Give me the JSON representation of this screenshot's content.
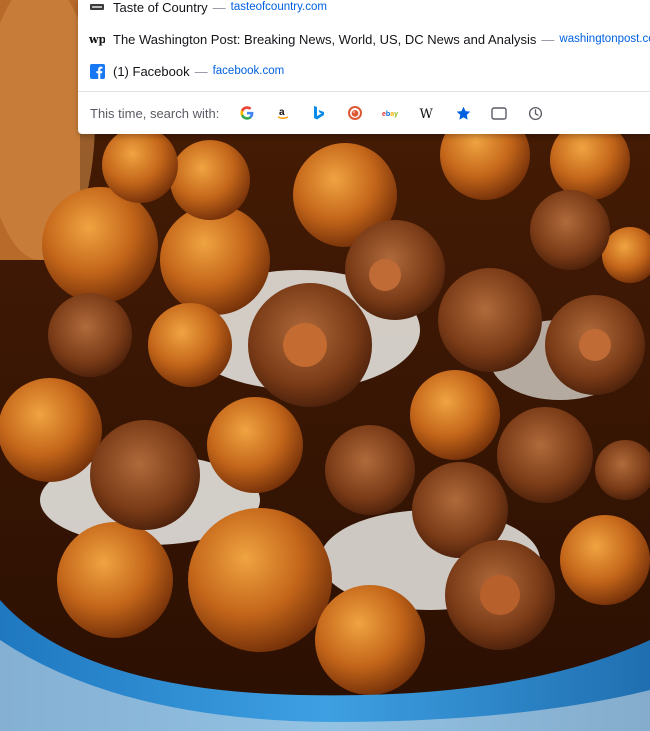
{
  "dropdown": {
    "results": [
      {
        "title": "Taste of Country",
        "separator": "—",
        "url": "tasteofcountry.com",
        "favicon": "taste-of-country-icon"
      },
      {
        "title": "The Washington Post: Breaking News, World, US, DC News and Analysis",
        "separator": "—",
        "url": "washingtonpost.com",
        "favicon": "washington-post-icon"
      },
      {
        "title": "(1) Facebook",
        "separator": "—",
        "url": "facebook.com",
        "favicon": "facebook-icon"
      }
    ],
    "search_with_label": "This time, search with:",
    "engines": [
      {
        "name": "google",
        "icon": "google-icon"
      },
      {
        "name": "amazon",
        "icon": "amazon-icon"
      },
      {
        "name": "bing",
        "icon": "bing-icon"
      },
      {
        "name": "duckduckgo",
        "icon": "duckduckgo-icon"
      },
      {
        "name": "ebay",
        "icon": "ebay-icon",
        "glyph": "ebay"
      },
      {
        "name": "wikipedia",
        "icon": "wikipedia-icon",
        "glyph": "W"
      },
      {
        "name": "bookmarks",
        "icon": "star-icon"
      },
      {
        "name": "tabs",
        "icon": "tab-icon"
      },
      {
        "name": "history",
        "icon": "clock-icon"
      }
    ]
  },
  "colors": {
    "url_blue": "#0061e0",
    "bookmark_star": "#0060df",
    "facebook_blue": "#1877f2",
    "pot_blue": "#2f8ccf"
  }
}
